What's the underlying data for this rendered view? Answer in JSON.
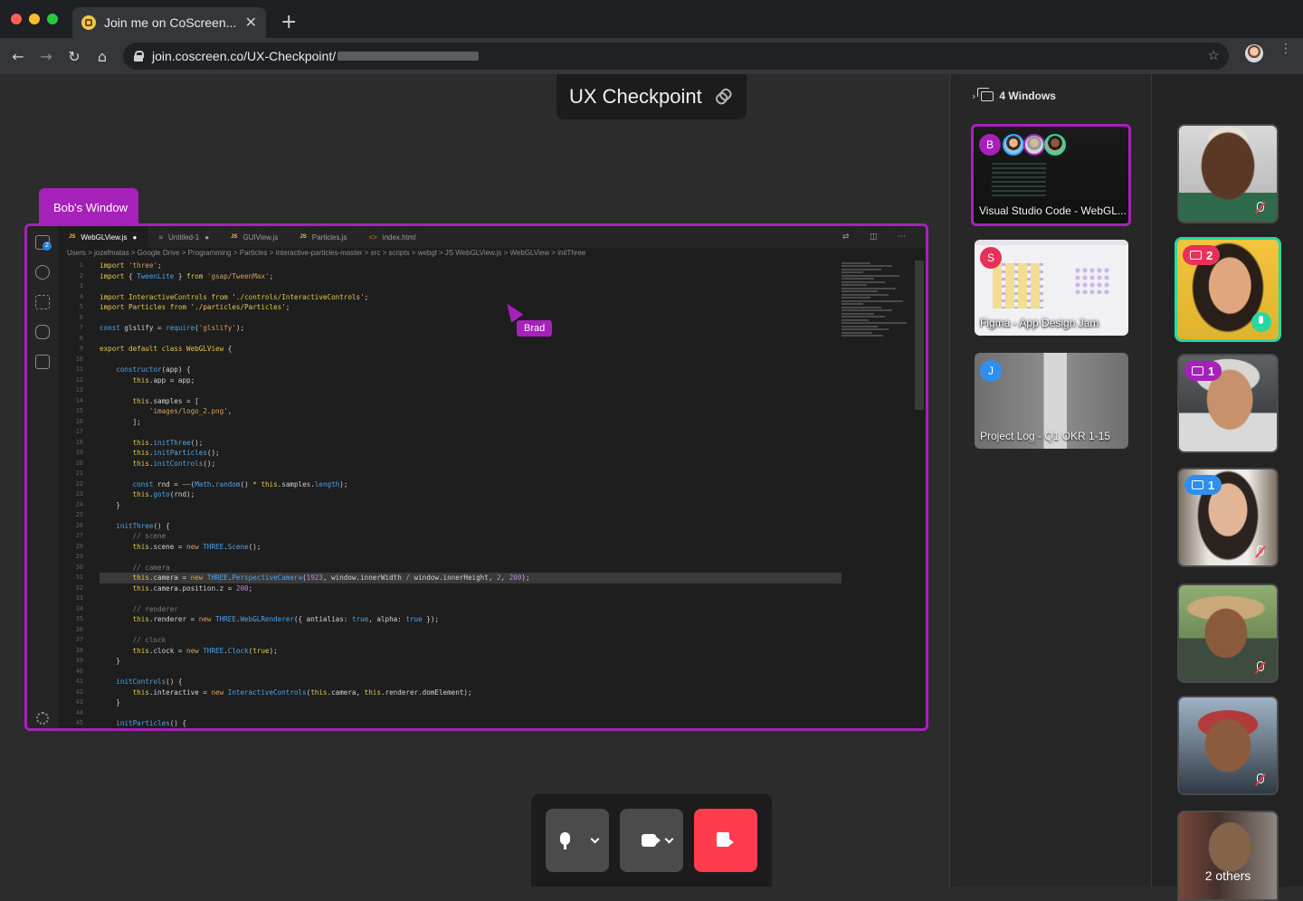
{
  "browser": {
    "tab_title": "Join me on CoScreen...",
    "tab_close": "✕",
    "new_tab": "+",
    "url": "join.coscreen.co/UX-Checkpoint/",
    "back": "←",
    "forward": "→",
    "reload": "↻",
    "home": "⌂",
    "bookmark": "☆",
    "menu": "⋮",
    "colors": {
      "close": "#ff5f57",
      "minimize": "#febc2e",
      "maximize": "#28c840"
    }
  },
  "session": {
    "title": "UX Checkpoint"
  },
  "shared_window": {
    "owner_label": "Bob's Window",
    "cursor_label": "Brad",
    "tabs": [
      {
        "label": "WebGLView.js",
        "icon": "JS",
        "dirty": "●"
      },
      {
        "label": "Untitled-1",
        "icon": "≡",
        "dirty": "●"
      },
      {
        "label": "GUIView.js",
        "icon": "JS",
        "dirty": ""
      },
      {
        "label": "Particles.js",
        "icon": "JS",
        "dirty": ""
      },
      {
        "label": "index.html",
        "icon": "<>",
        "dirty": ""
      }
    ],
    "breadcrumb": "Users > jozefmatas > Google Drive > Programming > Particles > interactive-particles-master > src > scripts > webgl > JS WebGLView.js > WebGLView > initThree",
    "activity_badge": "2",
    "line_numbers": "1\n2\n3\n4\n5\n6\n7\n8\n9\n10\n11\n12\n13\n14\n15\n16\n17\n18\n19\n20\n21\n22\n23\n24\n25\n26\n27\n28\n29\n30\n31\n32\n33\n34\n35\n36\n37\n38\n39\n40\n41\n42\n43\n44\n45"
  },
  "windows_panel": {
    "header": "4 Windows",
    "items": [
      {
        "label": "Visual Studio Code - WebGL...",
        "avatar": "B",
        "avatar_color": "#a521b9",
        "active": true
      },
      {
        "label": "Figma - App Design Jam",
        "avatar": "S",
        "avatar_color": "#e8305a",
        "active": false
      },
      {
        "label": "Project Log - Q1 OKR 1-15",
        "avatar": "J",
        "avatar_color": "#2f8ff0",
        "active": false
      }
    ]
  },
  "participants": [
    {
      "badge": "",
      "badge_color": "",
      "muted": true,
      "speaking": false
    },
    {
      "badge": "2",
      "badge_color": "#e8305a",
      "muted": false,
      "speaking": true
    },
    {
      "badge": "1",
      "badge_color": "#a521b9",
      "muted": false,
      "speaking": false
    },
    {
      "badge": "1",
      "badge_color": "#2f8ff0",
      "muted": true,
      "speaking": false
    },
    {
      "badge": "",
      "badge_color": "",
      "muted": true,
      "speaking": false
    },
    {
      "badge": "",
      "badge_color": "",
      "muted": true,
      "speaking": false
    }
  ],
  "others_label": "2 others",
  "controls": {
    "leave_color": "#ff3b4e",
    "button_color": "#4b4b4b"
  },
  "accent_color": "#a521b9",
  "speaking_color": "#25d9a0"
}
